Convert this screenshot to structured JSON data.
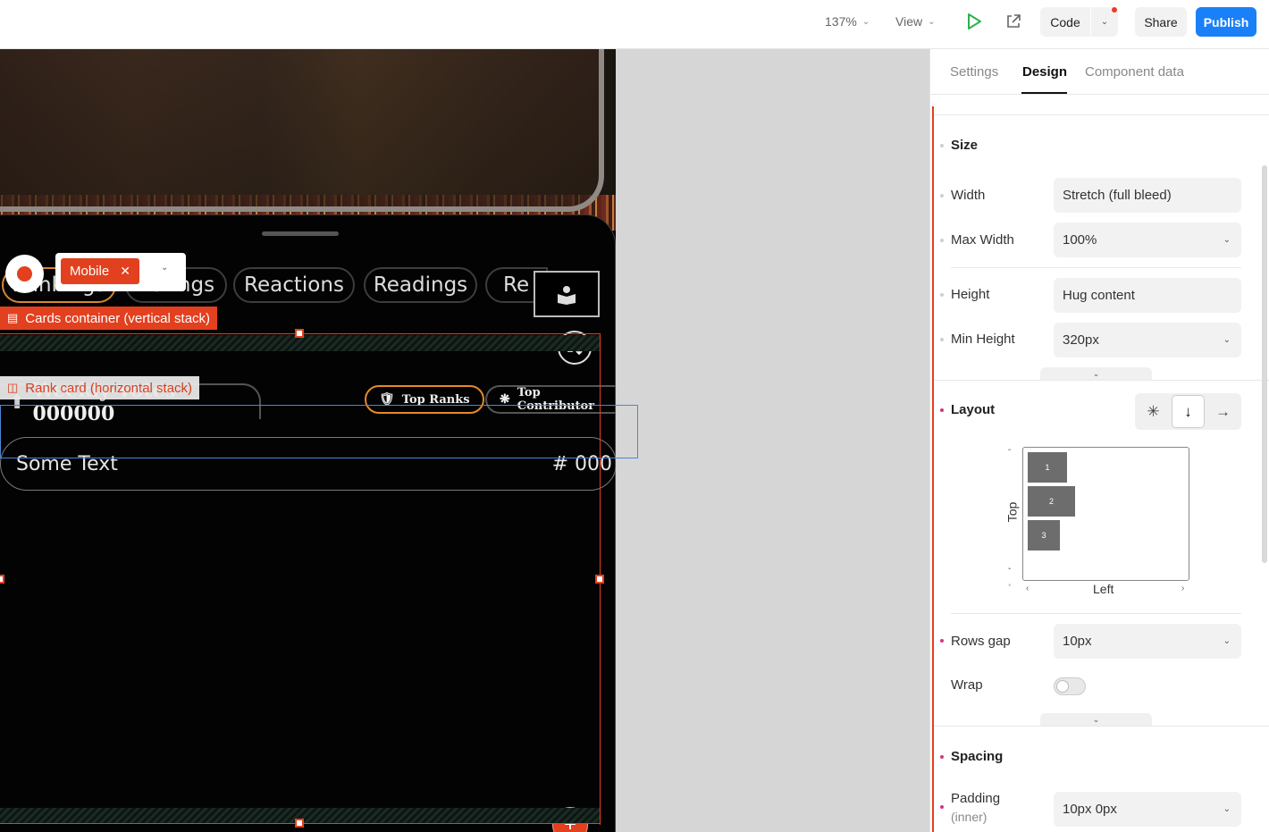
{
  "toolbar": {
    "zoom": "137%",
    "view": "View",
    "code": "Code",
    "share": "Share",
    "publish": "Publish"
  },
  "canvas": {
    "tabs": [
      "Rankings",
      "Ratings",
      "Reactions",
      "Readings",
      "Re"
    ],
    "selected_device": "Mobile",
    "cards_container_label": "Cards container (vertical stack)",
    "rank_card_label": "Rank card (horizontal stack)",
    "weekly_title": "Weekly-votes 000000",
    "chip_top_ranks": "Top Ranks",
    "chip_top_contributors": "Top Contributor",
    "card_text": "Some Text",
    "card_number": "# 000"
  },
  "panel": {
    "tabs": [
      "Settings",
      "Design",
      "Component data"
    ],
    "active_tab": "Design",
    "size": {
      "title": "Size",
      "width_label": "Width",
      "width_value": "Stretch (full bleed)",
      "max_width_label": "Max Width",
      "max_width_value": "100%",
      "height_label": "Height",
      "height_value": "Hug content",
      "min_height_label": "Min Height",
      "min_height_value": "320px"
    },
    "layout": {
      "title": "Layout",
      "items": [
        "1",
        "2",
        "3"
      ],
      "vertical_label": "Top",
      "horizontal_label": "Left",
      "rows_gap_label": "Rows gap",
      "rows_gap_value": "10px",
      "wrap_label": "Wrap",
      "wrap_on": false
    },
    "spacing": {
      "title": "Spacing",
      "padding_label": "Padding",
      "padding_sub": "(inner)",
      "padding_value": "10px 0px"
    }
  },
  "colors": {
    "accent_orange": "#e2401f",
    "publish_blue": "#1a80f7",
    "chip_orange": "#e48a2a"
  }
}
